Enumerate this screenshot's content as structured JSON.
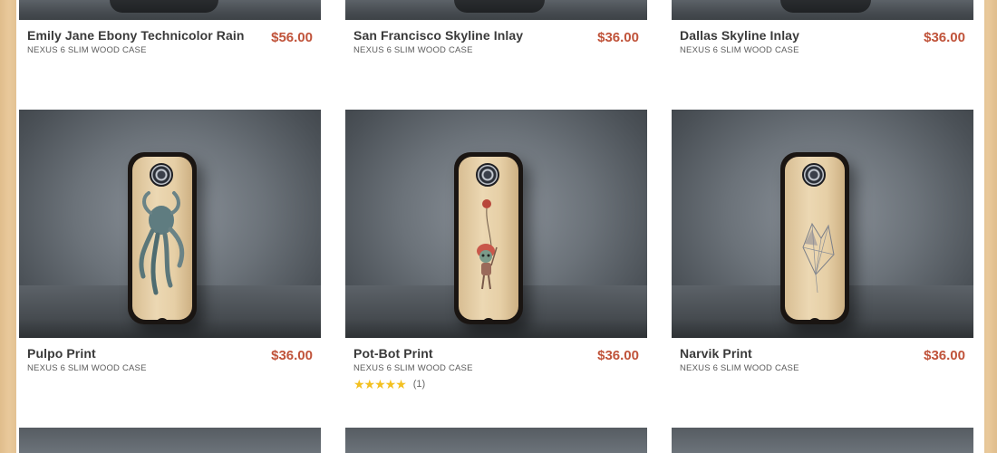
{
  "products": [
    {
      "name": "Emily Jane Ebony Technicolor Rain",
      "subtitle": "NEXUS 6 SLIM WOOD CASE",
      "price": "$56.00"
    },
    {
      "name": "San Francisco Skyline Inlay",
      "subtitle": "NEXUS 6 SLIM WOOD CASE",
      "price": "$36.00"
    },
    {
      "name": "Dallas Skyline Inlay",
      "subtitle": "NEXUS 6 SLIM WOOD CASE",
      "price": "$36.00"
    },
    {
      "name": "Pulpo Print",
      "subtitle": "NEXUS 6 SLIM WOOD CASE",
      "price": "$36.00"
    },
    {
      "name": "Pot-Bot Print",
      "subtitle": "NEXUS 6 SLIM WOOD CASE",
      "price": "$36.00",
      "rating": {
        "stars": "★★★★★",
        "count": "(1)",
        "value": 5
      }
    },
    {
      "name": "Narvik Print",
      "subtitle": "NEXUS 6 SLIM WOOD CASE",
      "price": "$36.00"
    }
  ],
  "icons": {
    "rating": "star-icon"
  },
  "colors": {
    "price": "#c0533a",
    "star": "#f3c020",
    "background_wood": "#e3c293"
  }
}
